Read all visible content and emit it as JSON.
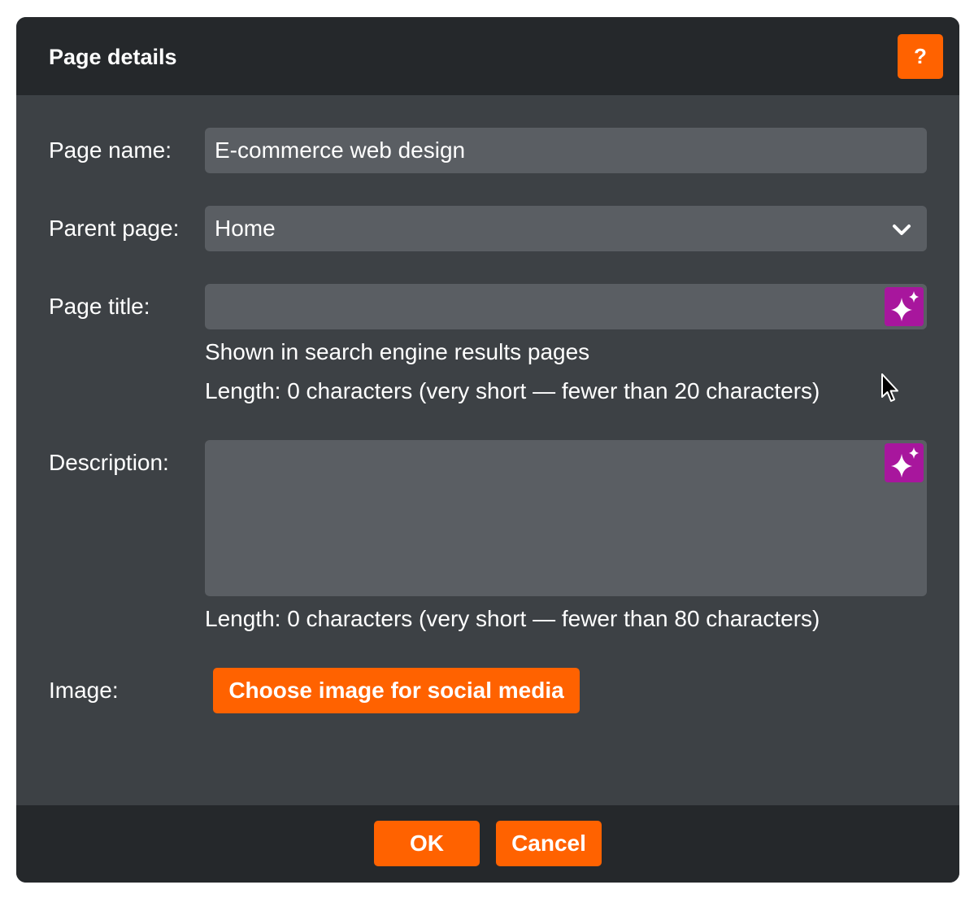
{
  "dialog": {
    "title": "Page details",
    "help_label": "?"
  },
  "form": {
    "page_name": {
      "label": "Page name:",
      "value": "E-commerce web design"
    },
    "parent_page": {
      "label": "Parent page:",
      "selected": "Home"
    },
    "page_title": {
      "label": "Page title:",
      "value": "",
      "hint": "Shown in search engine results pages",
      "length_info": "Length: 0 characters (very short — fewer than 20 characters)"
    },
    "description": {
      "label": "Description:",
      "value": "",
      "length_info": "Length: 0 characters (very short — fewer than 80 characters)"
    },
    "image": {
      "label": "Image:",
      "button_label": "Choose image for social media"
    }
  },
  "footer": {
    "ok_label": "OK",
    "cancel_label": "Cancel"
  },
  "colors": {
    "accent": "#ff6200",
    "ai_button": "#a8169d",
    "dialog_bg": "#3d4145",
    "header_bg": "#25282b",
    "field_bg": "#5a5e63"
  },
  "icons": {
    "help": "question-mark-icon",
    "dropdown": "chevron-down-icon",
    "ai": "sparkle-icon",
    "pointer": "mouse-pointer-icon"
  }
}
